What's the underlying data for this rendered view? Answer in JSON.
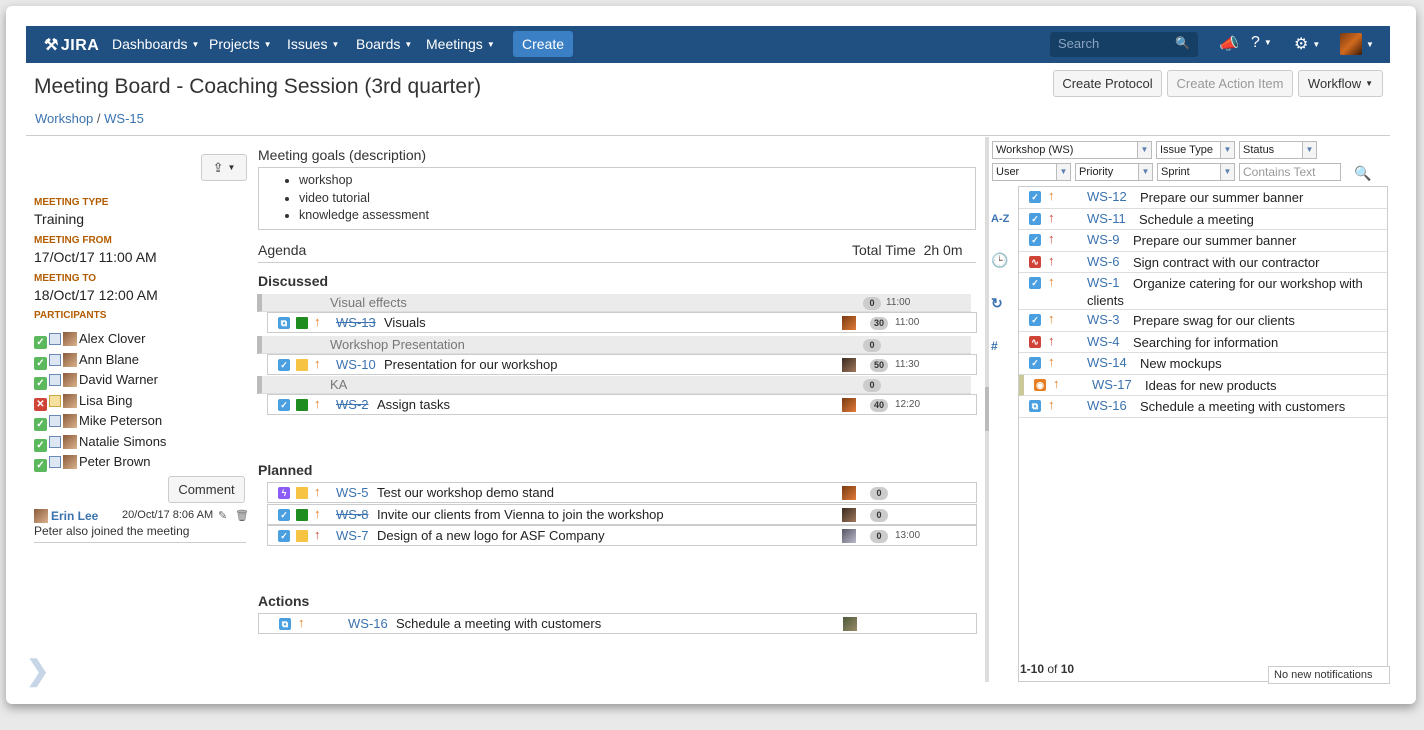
{
  "nav": {
    "logo": "JIRA",
    "items": [
      "Dashboards",
      "Projects",
      "Issues",
      "Boards",
      "Meetings"
    ],
    "create": "Create",
    "search_placeholder": "Search"
  },
  "page": {
    "title": "Meeting Board - Coaching Session (3rd quarter)",
    "breadcrumb": [
      "Workshop",
      "WS-15"
    ],
    "buttons": [
      "Create Protocol",
      "Create Action Item",
      "Workflow"
    ]
  },
  "meeting": {
    "type_label": "MEETING TYPE",
    "type": "Training",
    "from_label": "MEETING FROM",
    "from": "17/Oct/17 11:00 AM",
    "to_label": "MEETING TO",
    "to": "18/Oct/17 12:00 AM",
    "participants_label": "PARTICIPANTS",
    "participants": [
      {
        "name": "Alex Clover",
        "accepted": true
      },
      {
        "name": "Ann Blane",
        "accepted": true
      },
      {
        "name": "David Warner",
        "accepted": true
      },
      {
        "name": "Lisa Bing",
        "accepted": false
      },
      {
        "name": "Mike Peterson",
        "accepted": true
      },
      {
        "name": "Natalie Simons",
        "accepted": true
      },
      {
        "name": "Peter Brown",
        "accepted": true
      }
    ],
    "comment_button": "Comment",
    "comment": {
      "author": "Erin Lee",
      "date": "20/Oct/17 8:06 AM",
      "text": "Peter also joined the meeting"
    }
  },
  "goals": {
    "title": "Meeting goals (description)",
    "items": [
      "workshop",
      "video tutorial",
      "knowledge assessment"
    ]
  },
  "agenda": {
    "title": "Agenda",
    "total_label": "Total Time",
    "total": "2h 0m",
    "discussed_label": "Discussed",
    "discussed": [
      {
        "topic": "Visual effects",
        "badge": "0",
        "time": "11:00",
        "issue": {
          "key": "WS-13",
          "done": true,
          "summary": "Visuals",
          "badge": "30",
          "time": "11:00"
        }
      },
      {
        "topic": "Workshop Presentation",
        "badge": "0",
        "time": "",
        "issue": {
          "key": "WS-10",
          "done": false,
          "summary": "Presentation for our workshop",
          "badge": "50",
          "time": "11:30"
        }
      },
      {
        "topic": "KA",
        "badge": "0",
        "time": "",
        "issue": {
          "key": "WS-2",
          "done": true,
          "summary": "Assign tasks",
          "badge": "40",
          "time": "12:20"
        }
      }
    ],
    "planned_label": "Planned",
    "planned": [
      {
        "key": "WS-5",
        "done": false,
        "summary": "Test our workshop demo stand",
        "badge": "0",
        "time": ""
      },
      {
        "key": "WS-8",
        "done": true,
        "summary": "Invite our clients from Vienna to join the workshop",
        "badge": "0",
        "time": ""
      },
      {
        "key": "WS-7",
        "done": false,
        "summary": "Design of a new logo for ASF Company",
        "badge": "0",
        "time": "13:00"
      }
    ],
    "actions_label": "Actions",
    "actions": [
      {
        "key": "WS-16",
        "summary": "Schedule a meeting with customers"
      }
    ]
  },
  "filters": {
    "project": "Workshop (WS)",
    "issue_type": "Issue Type",
    "status": "Status",
    "user": "User",
    "priority": "Priority",
    "sprint": "Sprint",
    "text_placeholder": "Contains Text"
  },
  "side_icons": {
    "az": "A-Z",
    "hash": "#"
  },
  "backlog": [
    {
      "key": "WS-12",
      "summary": "Prepare our summer banner"
    },
    {
      "key": "WS-11",
      "summary": "Schedule a meeting"
    },
    {
      "key": "WS-9",
      "summary": "Prepare our summer banner"
    },
    {
      "key": "WS-6",
      "summary": "Sign contract with our contractor"
    },
    {
      "key": "WS-1",
      "summary": "Organize catering for our workshop with clients"
    },
    {
      "key": "WS-3",
      "summary": "Prepare swag for our clients"
    },
    {
      "key": "WS-4",
      "summary": "Searching for information"
    },
    {
      "key": "WS-14",
      "summary": "New mockups"
    },
    {
      "key": "WS-17",
      "summary": "Ideas for new products"
    },
    {
      "key": "WS-16",
      "summary": "Schedule a meeting with customers"
    }
  ],
  "paging": {
    "range": "1-10",
    "of": "of",
    "total": "10"
  },
  "notifications": "No new notifications",
  "colors": {
    "nav": "#205081",
    "link": "#3b73af",
    "accent_orange": "#b35c00",
    "priority_high": "#d04437",
    "priority_med": "#e67e22"
  }
}
